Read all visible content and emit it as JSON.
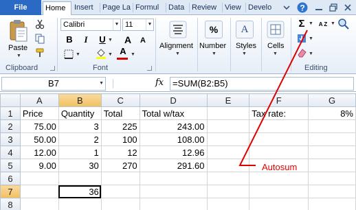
{
  "tabs": {
    "file": "File",
    "items": [
      "Home",
      "Insert",
      "Page La",
      "Formul",
      "Data",
      "Review",
      "View",
      "Develo"
    ],
    "active_index": 0
  },
  "ribbon": {
    "clipboard": {
      "paste_label": "Paste",
      "group_label": "Clipboard"
    },
    "font": {
      "font_name": "Calibri",
      "font_size": "11",
      "bold": "B",
      "italic": "I",
      "underline": "U",
      "grow": "A",
      "shrink": "A",
      "font_color_letter": "A",
      "group_label": "Font",
      "font_color": "#d40000",
      "fill_color": "#ffff00"
    },
    "alignment": {
      "label": "Alignment"
    },
    "number": {
      "label": "Number",
      "glyph": "%"
    },
    "styles": {
      "label": "Styles",
      "glyph": "A"
    },
    "cells": {
      "label": "Cells"
    },
    "editing": {
      "group_label": "Editing",
      "sigma": "Σ",
      "sort_glyph": "A Z"
    }
  },
  "formula_bar": {
    "name_box": "B7",
    "fx": "fx",
    "formula": "=SUM(B2:B5)"
  },
  "grid": {
    "columns": [
      "A",
      "B",
      "C",
      "D",
      "E",
      "F",
      "G"
    ],
    "selected_column": "B",
    "selected_row": "7",
    "rows": [
      {
        "n": "1",
        "cells": [
          "Price",
          "Quantity",
          "Total",
          "Total w/tax",
          "",
          "Tax rate:",
          "8%"
        ]
      },
      {
        "n": "2",
        "cells": [
          "75.00",
          "3",
          "225",
          "243.00",
          "",
          "",
          ""
        ]
      },
      {
        "n": "3",
        "cells": [
          "50.00",
          "2",
          "100",
          "108.00",
          "",
          "",
          ""
        ]
      },
      {
        "n": "4",
        "cells": [
          "12.00",
          "1",
          "12",
          "12.96",
          "",
          "",
          ""
        ]
      },
      {
        "n": "5",
        "cells": [
          "9.00",
          "30",
          "270",
          "291.60",
          "",
          "",
          ""
        ]
      },
      {
        "n": "6",
        "cells": [
          "",
          "",
          "",
          "",
          "",
          "",
          ""
        ]
      },
      {
        "n": "7",
        "cells": [
          "",
          "36",
          "",
          "",
          "",
          "",
          ""
        ]
      },
      {
        "n": "8",
        "cells": [
          "",
          "",
          "",
          "",
          "",
          "",
          ""
        ]
      }
    ]
  },
  "annotation": {
    "label": "Autosum",
    "color": "#e00000"
  }
}
